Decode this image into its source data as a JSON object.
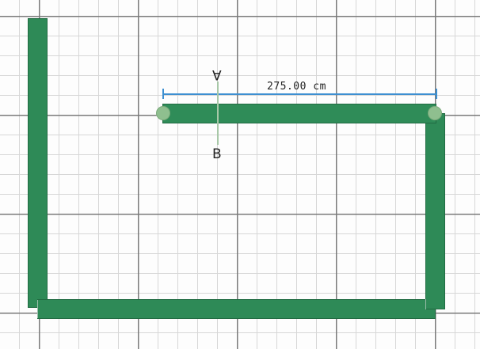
{
  "canvas": {
    "grid_color_minor": "#d7d7d7",
    "grid_color_major": "#7a7a7a",
    "wall_color": "#2e8a57",
    "handle_color": "#8fbf8f",
    "dimension_color": "#3d8fd1"
  },
  "selected_wall": {
    "dimension_label": "275.00 cm"
  },
  "section_marker": {
    "start_label": "A",
    "end_label": "B"
  }
}
